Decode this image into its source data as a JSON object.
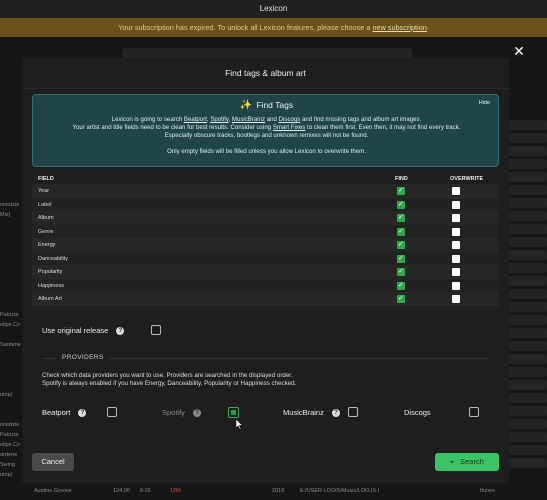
{
  "app": {
    "title": "Lexicon"
  },
  "banner": {
    "text": "Your subscription has expired. To unlock all Lexicon features, please choose a ",
    "link": "new subscription",
    "suffix": "."
  },
  "background": {
    "left_fragments": [
      "onedzie",
      "Mix)",
      "",
      "",
      "",
      "",
      "",
      "",
      "",
      "",
      "",
      "Patrizia",
      "elipe Co",
      "",
      "Sardene",
      "",
      "",
      "",
      "",
      "ump)",
      "",
      "",
      "onedzie",
      "Patrizia",
      "elipe Co",
      "ardene",
      "Swing",
      "ump)"
    ],
    "bottom_row": {
      "title": "Austins Groove",
      "bpm": "124.00",
      "time": "6:02",
      "key": "12M",
      "year": "2019",
      "path": "E:/USER LOOIS/Music/LOO.IS.I",
      "source": "Itunes"
    }
  },
  "modal": {
    "title": "Find tags & album art",
    "info": {
      "heading": "Find Tags",
      "hide_label": "Hide",
      "line1_pre": "Lexicon is going to search ",
      "providers_links": [
        "Beatport",
        "Spotify",
        "MusicBrainz",
        "Discogs"
      ],
      "line1_post": " and find missing tags and album art images.",
      "line2_pre": "Your artist and title fields need to be clean for best results. Consider using ",
      "line2_link": "Smart Fixes",
      "line2_post": " to clean them first. Even then, it may not find every track.",
      "line3": "Especially obscure tracks, bootlegs and unknown remixes will not be found.",
      "line4": "Only empty fields will be filled unless you allow Lexicon to overwrite them."
    },
    "table": {
      "col_field": "FIELD",
      "col_find": "FIND",
      "col_overwrite": "OVERWRITE",
      "rows": [
        {
          "label": "Year",
          "find": true,
          "overwrite": false
        },
        {
          "label": "Label",
          "find": true,
          "overwrite": false
        },
        {
          "label": "Album",
          "find": true,
          "overwrite": false
        },
        {
          "label": "Genre",
          "find": true,
          "overwrite": false
        },
        {
          "label": "Energy",
          "find": true,
          "overwrite": false
        },
        {
          "label": "Danceability",
          "find": true,
          "overwrite": false
        },
        {
          "label": "Popularity",
          "find": true,
          "overwrite": false
        },
        {
          "label": "Happiness",
          "find": true,
          "overwrite": false
        },
        {
          "label": "Album Art",
          "find": true,
          "overwrite": false
        }
      ]
    },
    "use_original_release": {
      "label": "Use original release",
      "checked": false
    },
    "providers": {
      "section_label": "PROVIDERS",
      "description_1": "Check which data providers you want to use. Providers are searched in the displayed order.",
      "description_2": "Spotify is always enabled if you have Energy, Danceability, Popularity or Happiness checked.",
      "items": [
        {
          "label": "Beatport",
          "checked": false,
          "disabled": false
        },
        {
          "label": "Spotify",
          "checked": true,
          "disabled": true
        },
        {
          "label": "MusicBrainz",
          "checked": false,
          "disabled": false
        },
        {
          "label": "Discogs",
          "checked": false,
          "disabled": false
        }
      ]
    },
    "buttons": {
      "cancel": "Cancel",
      "search": "Search"
    }
  },
  "colors": {
    "accent_green": "#3cc366",
    "info_bg": "#1f4548",
    "banner_bg": "#6a5118"
  }
}
